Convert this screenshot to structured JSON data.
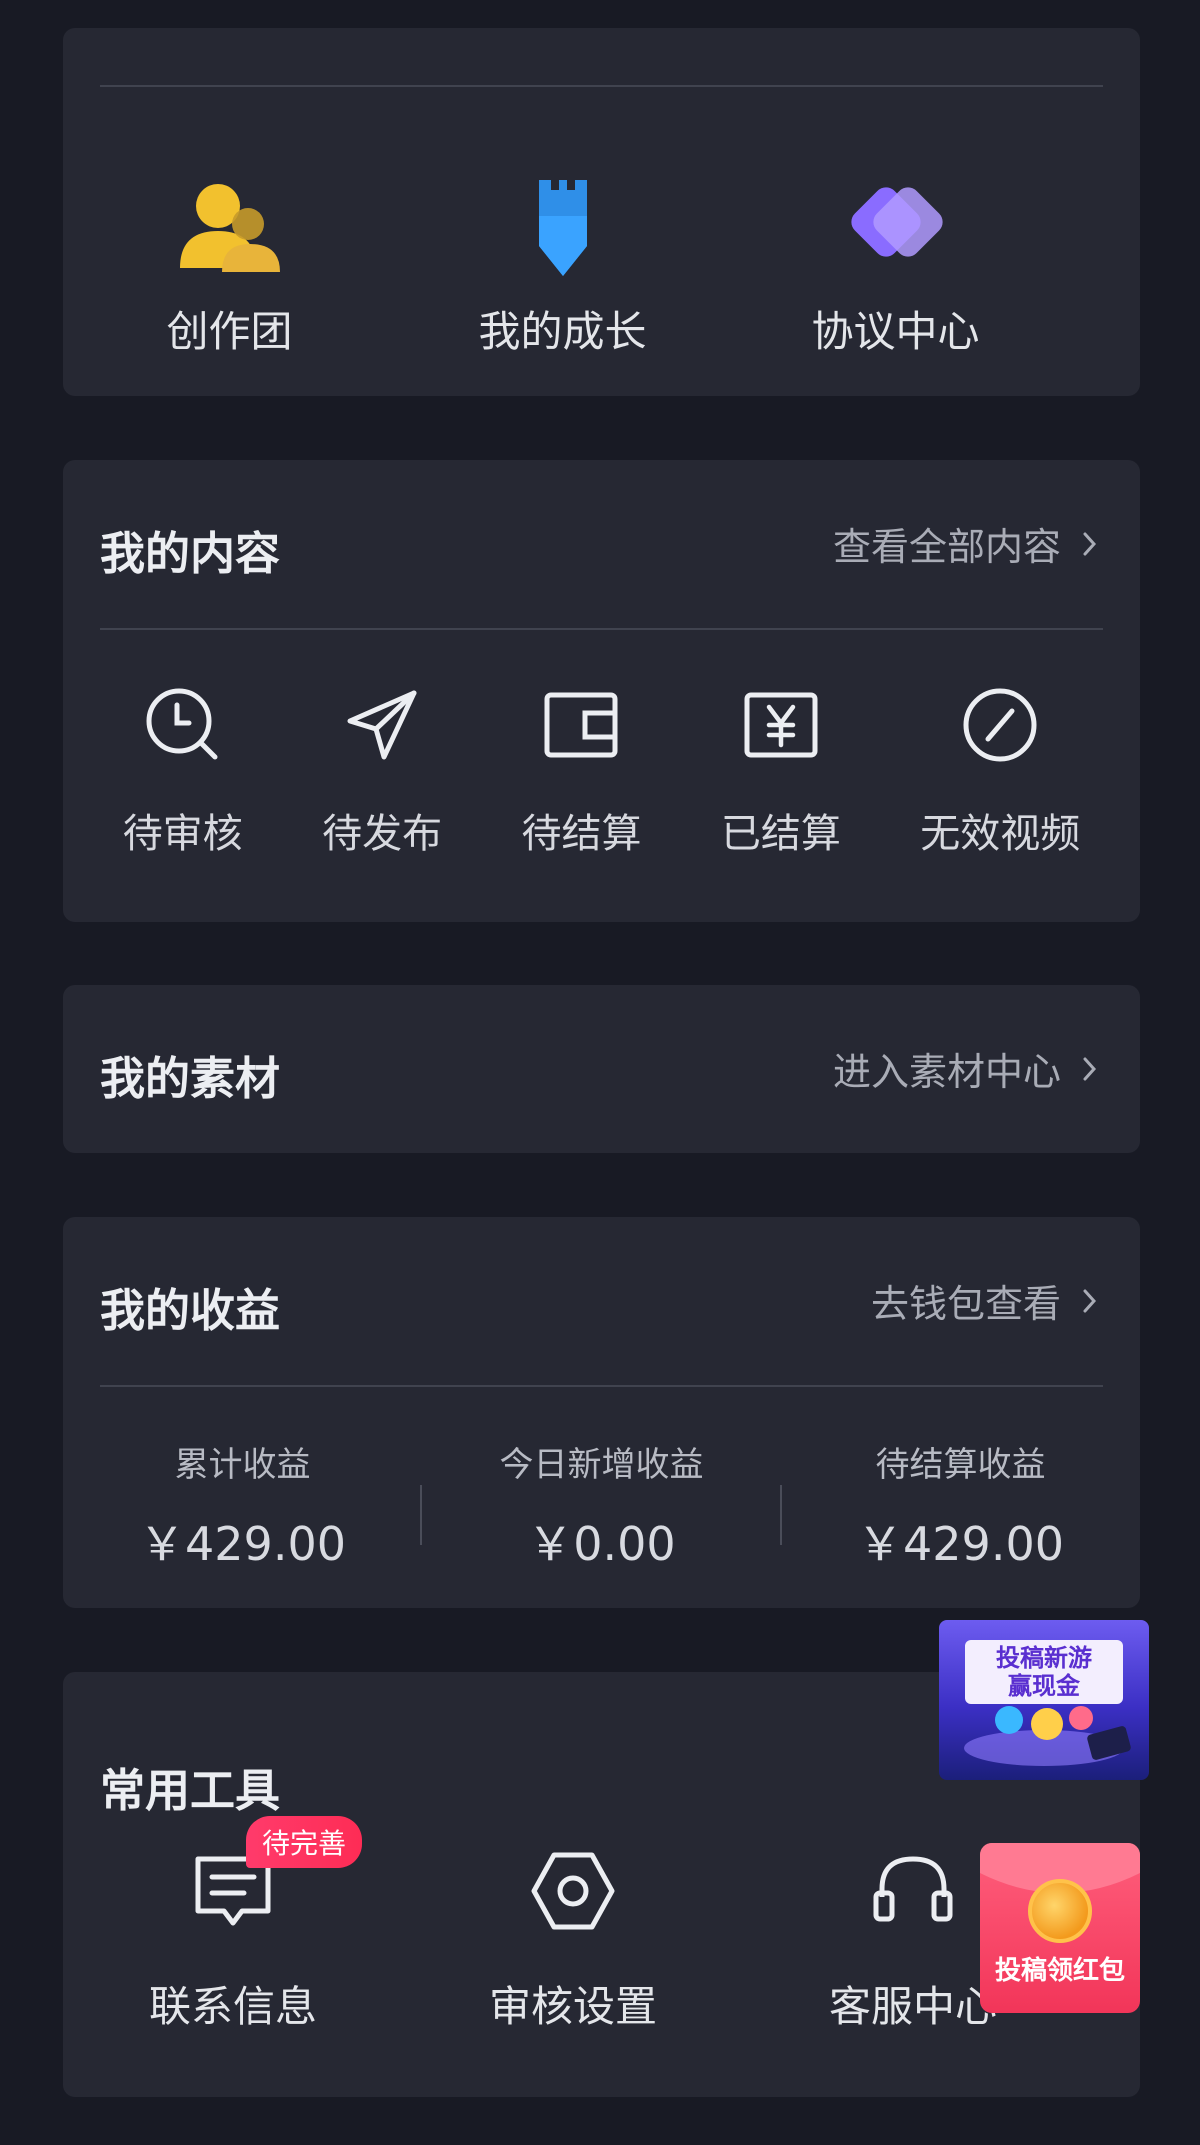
{
  "top_shortcuts": [
    {
      "label": "创作团",
      "icon": "creator-team-icon"
    },
    {
      "label": "我的成长",
      "icon": "growth-tower-icon"
    },
    {
      "label": "协议中心",
      "icon": "agreement-handshake-icon"
    }
  ],
  "content": {
    "title": "我的内容",
    "link": "查看全部内容",
    "items": [
      {
        "label": "待审核",
        "icon": "clock-search-icon"
      },
      {
        "label": "待发布",
        "icon": "paper-plane-icon"
      },
      {
        "label": "待结算",
        "icon": "wallet-icon"
      },
      {
        "label": "已结算",
        "icon": "yen-receipt-icon"
      },
      {
        "label": "无效视频",
        "icon": "invalid-slash-icon"
      }
    ]
  },
  "material": {
    "title": "我的素材",
    "link": "进入素材中心"
  },
  "earnings": {
    "title": "我的收益",
    "link": "去钱包查看",
    "stats": [
      {
        "label": "累计收益",
        "value": "￥429.00"
      },
      {
        "label": "今日新增收益",
        "value": "￥0.00"
      },
      {
        "label": "待结算收益",
        "value": "￥429.00"
      }
    ]
  },
  "tools": {
    "title": "常用工具",
    "items": [
      {
        "label": "联系信息",
        "icon": "message-icon",
        "badge": "待完善"
      },
      {
        "label": "审核设置",
        "icon": "hexagon-settings-icon"
      },
      {
        "label": "客服中心",
        "icon": "headset-icon"
      }
    ]
  },
  "promo": {
    "text_line1": "投稿新游",
    "text_line2": "赢现金"
  },
  "redpack": {
    "text": "投稿领红包"
  }
}
